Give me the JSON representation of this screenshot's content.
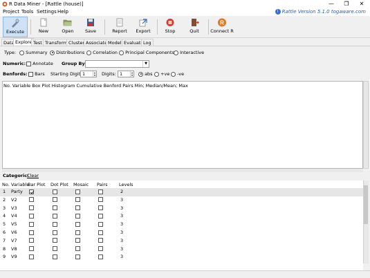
{
  "window": {
    "title": "R Data Miner - [Rattle (house)]",
    "controls": {
      "minimize": "—",
      "maximize": "❐",
      "close": "✕"
    }
  },
  "menu": {
    "items": [
      "Project",
      "Tools",
      "Settings",
      "Help"
    ],
    "version": "Rattle Version 5.1.0 togaware.com",
    "version_icon": "i"
  },
  "toolbar": {
    "buttons": [
      {
        "label": "Execute",
        "icon": "execute-icon"
      },
      {
        "label": "New",
        "icon": "new-icon"
      },
      {
        "label": "Open",
        "icon": "open-icon"
      },
      {
        "label": "Save",
        "icon": "save-icon"
      },
      {
        "label": "Report",
        "icon": "report-icon"
      },
      {
        "label": "Export",
        "icon": "export-icon"
      },
      {
        "label": "Stop",
        "icon": "stop-icon"
      },
      {
        "label": "Quit",
        "icon": "quit-icon"
      },
      {
        "label": "Connect R",
        "icon": "connect-r-icon"
      }
    ]
  },
  "tabs": [
    "Data",
    "Explore",
    "Test",
    "Transform",
    "Cluster",
    "Associate",
    "Model",
    "Evaluate",
    "Log"
  ],
  "active_tab": "Explore",
  "type_row": {
    "label": "Type:",
    "options": [
      "Summary",
      "Distributions",
      "Correlation",
      "Principal Components",
      "Interactive"
    ],
    "selected": "Distributions"
  },
  "numeric_row": {
    "label": "Numeric:",
    "annotate": "Annotate",
    "group_by": "Group By:",
    "group_value": ""
  },
  "benfords_row": {
    "label": "Benfords:",
    "bars": "Bars",
    "starting_digit_label": "Starting Digit:",
    "starting_digit": "1",
    "digits_label": "Digits:",
    "digits": "1",
    "sign_options": [
      "abs",
      "+ve",
      "-ve"
    ],
    "sign_selected": "abs"
  },
  "numeric_header": "No. Variable Box Plot Histogram Cumulative Benford Pairs Min; Median/Mean; Max",
  "categoric": {
    "label": "Categoric:",
    "clear": "Clear",
    "columns": [
      "No.",
      "Variable",
      "Bar Plot",
      "Dot Plot",
      "Mosaic",
      "Pairs",
      "Levels"
    ],
    "rows": [
      {
        "no": "1",
        "var": "Party",
        "bar": true,
        "dot": false,
        "mosaic": false,
        "pairs": false,
        "levels": "2"
      },
      {
        "no": "2",
        "var": "V2",
        "bar": false,
        "dot": false,
        "mosaic": false,
        "pairs": false,
        "levels": "3"
      },
      {
        "no": "3",
        "var": "V3",
        "bar": false,
        "dot": false,
        "mosaic": false,
        "pairs": false,
        "levels": "3"
      },
      {
        "no": "4",
        "var": "V4",
        "bar": false,
        "dot": false,
        "mosaic": false,
        "pairs": false,
        "levels": "3"
      },
      {
        "no": "5",
        "var": "V5",
        "bar": false,
        "dot": false,
        "mosaic": false,
        "pairs": false,
        "levels": "3"
      },
      {
        "no": "6",
        "var": "V6",
        "bar": false,
        "dot": false,
        "mosaic": false,
        "pairs": false,
        "levels": "3"
      },
      {
        "no": "7",
        "var": "V7",
        "bar": false,
        "dot": false,
        "mosaic": false,
        "pairs": false,
        "levels": "3"
      },
      {
        "no": "8",
        "var": "V8",
        "bar": false,
        "dot": false,
        "mosaic": false,
        "pairs": false,
        "levels": "3"
      },
      {
        "no": "9",
        "var": "V9",
        "bar": false,
        "dot": false,
        "mosaic": false,
        "pairs": false,
        "levels": "3"
      }
    ]
  }
}
